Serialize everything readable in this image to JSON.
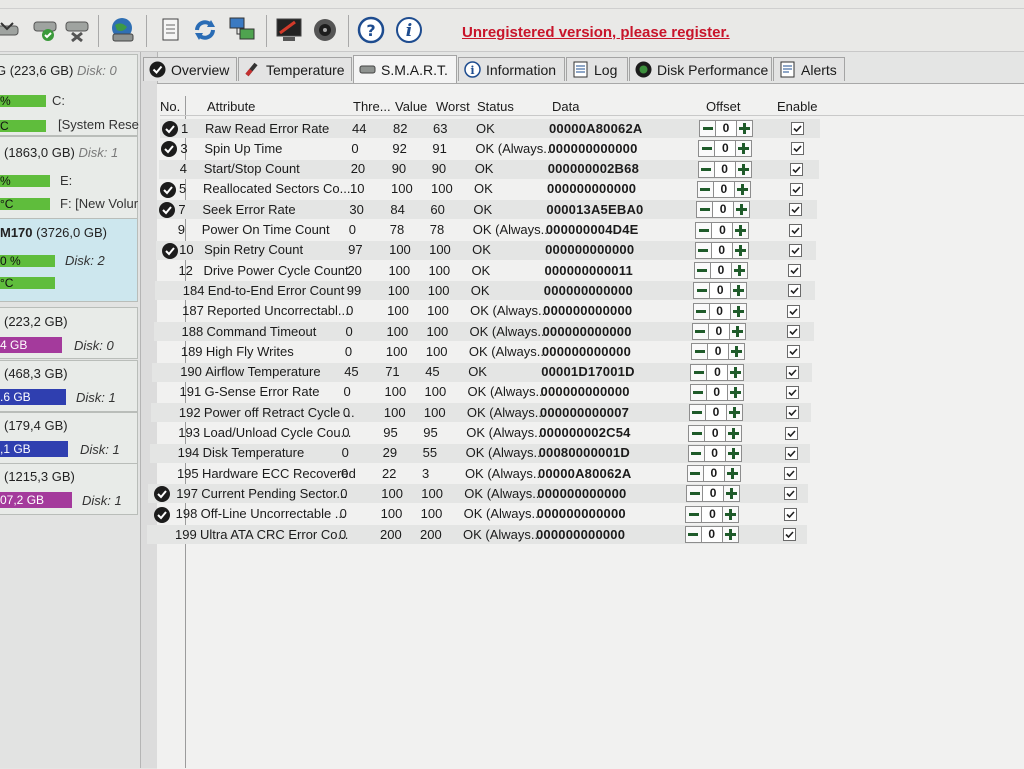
{
  "banner": "Unregistered version, please register.",
  "toolbar_icons": [
    "disk-check-icon",
    "disk-ok-icon",
    "disk-tools-icon",
    "globe-disk-icon",
    "document-icon",
    "refresh-icon",
    "network-icon",
    "monitor-icon",
    "speaker-icon",
    "help-icon",
    "info-icon"
  ],
  "disks": [
    {
      "title": "G (223,6 GB)",
      "disk": "Disk: 0",
      "lines": [
        {
          "pct": "%",
          "drive": "C:"
        },
        {
          "pct": "C",
          "drive": "[System Rese"
        }
      ]
    },
    {
      "title": "(1863,0 GB)",
      "disk": "Disk: 1",
      "lines": [
        {
          "pct": "%",
          "drive": "E:"
        },
        {
          "pct": "°C",
          "drive": "F: [New Volur"
        }
      ]
    },
    {
      "title": "M170",
      "size": "(3726,0 GB)",
      "disk": "Disk: 2",
      "lines": [
        {
          "pct": "0 %"
        },
        {
          "pct": "°C"
        }
      ]
    },
    {
      "title": "(223,2 GB)",
      "bar": "4 GB",
      "disk": "Disk: 0",
      "color": "#a43a9c"
    },
    {
      "title": "(468,3 GB)",
      "bar": ".6 GB",
      "disk": "Disk: 1",
      "color": "#2f3fb0"
    },
    {
      "title": "(179,4 GB)",
      "bar": ",1 GB",
      "disk": "Disk: 1",
      "color": "#2f3fb0"
    },
    {
      "title": "(1215,3 GB)",
      "bar": "07,2 GB",
      "disk": "Disk: 1",
      "color": "#a43a9c"
    }
  ],
  "tabs": [
    "Overview",
    "Temperature",
    "S.M.A.R.T.",
    "Information",
    "Log",
    "Disk Performance",
    "Alerts"
  ],
  "active_tab": "S.M.A.R.T.",
  "columns": {
    "no": "No.",
    "attribute": "Attribute",
    "threshold": "Thre...",
    "value": "Value",
    "worst": "Worst",
    "status": "Status",
    "data": "Data",
    "offset": "Offset",
    "enable": "Enable"
  },
  "smart_rows": [
    {
      "no": "1",
      "attr": "Raw Read Error Rate",
      "thr": "44",
      "val": "82",
      "worst": "63",
      "status": "OK",
      "data": "00000A80062A",
      "offset": "0",
      "icon": true,
      "hl": true
    },
    {
      "no": "3",
      "attr": "Spin Up Time",
      "thr": "0",
      "val": "92",
      "worst": "91",
      "status": "OK (Always...",
      "data": "000000000000",
      "offset": "0",
      "icon": true,
      "hl": false
    },
    {
      "no": "4",
      "attr": "Start/Stop Count",
      "thr": "20",
      "val": "90",
      "worst": "90",
      "status": "OK",
      "data": "000000002B68",
      "offset": "0",
      "icon": false,
      "hl": true
    },
    {
      "no": "5",
      "attr": "Reallocated Sectors Co...",
      "thr": "10",
      "val": "100",
      "worst": "100",
      "status": "OK",
      "data": "000000000000",
      "offset": "0",
      "icon": true,
      "hl": false
    },
    {
      "no": "7",
      "attr": "Seek Error Rate",
      "thr": "30",
      "val": "84",
      "worst": "60",
      "status": "OK",
      "data": "000013A5EBA0",
      "offset": "0",
      "icon": true,
      "hl": true
    },
    {
      "no": "9",
      "attr": "Power On Time Count",
      "thr": "0",
      "val": "78",
      "worst": "78",
      "status": "OK (Always...",
      "data": "000000004D4E",
      "offset": "0",
      "icon": false,
      "hl": false
    },
    {
      "no": "10",
      "attr": "Spin Retry Count",
      "thr": "97",
      "val": "100",
      "worst": "100",
      "status": "OK",
      "data": "000000000000",
      "offset": "0",
      "icon": true,
      "hl": true
    },
    {
      "no": "12",
      "attr": "Drive Power Cycle Count",
      "thr": "20",
      "val": "100",
      "worst": "100",
      "status": "OK",
      "data": "000000000011",
      "offset": "0",
      "icon": false,
      "hl": false
    },
    {
      "no": "184",
      "attr": "End-to-End Error Count",
      "thr": "99",
      "val": "100",
      "worst": "100",
      "status": "OK",
      "data": "000000000000",
      "offset": "0",
      "icon": false,
      "hl": true
    },
    {
      "no": "187",
      "attr": "Reported Uncorrectabl...",
      "thr": "0",
      "val": "100",
      "worst": "100",
      "status": "OK (Always...",
      "data": "000000000000",
      "offset": "0",
      "icon": false,
      "hl": false
    },
    {
      "no": "188",
      "attr": "Command Timeout",
      "thr": "0",
      "val": "100",
      "worst": "100",
      "status": "OK (Always...",
      "data": "000000000000",
      "offset": "0",
      "icon": false,
      "hl": true
    },
    {
      "no": "189",
      "attr": "High Fly Writes",
      "thr": "0",
      "val": "100",
      "worst": "100",
      "status": "OK (Always...",
      "data": "000000000000",
      "offset": "0",
      "icon": false,
      "hl": false
    },
    {
      "no": "190",
      "attr": "Airflow Temperature",
      "thr": "45",
      "val": "71",
      "worst": "45",
      "status": "OK",
      "data": "00001D17001D",
      "offset": "0",
      "icon": false,
      "hl": true
    },
    {
      "no": "191",
      "attr": "G-Sense Error Rate",
      "thr": "0",
      "val": "100",
      "worst": "100",
      "status": "OK (Always...",
      "data": "000000000000",
      "offset": "0",
      "icon": false,
      "hl": false
    },
    {
      "no": "192",
      "attr": "Power off Retract Cycle ...",
      "thr": "0",
      "val": "100",
      "worst": "100",
      "status": "OK (Always...",
      "data": "000000000007",
      "offset": "0",
      "icon": false,
      "hl": true
    },
    {
      "no": "193",
      "attr": "Load/Unload Cycle Cou...",
      "thr": "0",
      "val": "95",
      "worst": "95",
      "status": "OK (Always...",
      "data": "000000002C54",
      "offset": "0",
      "icon": false,
      "hl": false
    },
    {
      "no": "194",
      "attr": "Disk Temperature",
      "thr": "0",
      "val": "29",
      "worst": "55",
      "status": "OK (Always...",
      "data": "00080000001D",
      "offset": "0",
      "icon": false,
      "hl": true
    },
    {
      "no": "195",
      "attr": "Hardware ECC Recovered",
      "thr": "0",
      "val": "22",
      "worst": "3",
      "status": "OK (Always...",
      "data": "00000A80062A",
      "offset": "0",
      "icon": false,
      "hl": false
    },
    {
      "no": "197",
      "attr": "Current Pending Sector...",
      "thr": "0",
      "val": "100",
      "worst": "100",
      "status": "OK (Always...",
      "data": "000000000000",
      "offset": "0",
      "icon": true,
      "hl": true
    },
    {
      "no": "198",
      "attr": "Off-Line Uncorrectable ...",
      "thr": "0",
      "val": "100",
      "worst": "100",
      "status": "OK (Always...",
      "data": "000000000000",
      "offset": "0",
      "icon": true,
      "hl": false
    },
    {
      "no": "199",
      "attr": "Ultra ATA CRC Error Co...",
      "thr": "0",
      "val": "200",
      "worst": "200",
      "status": "OK (Always...",
      "data": "000000000000",
      "offset": "0",
      "icon": false,
      "hl": true
    }
  ]
}
